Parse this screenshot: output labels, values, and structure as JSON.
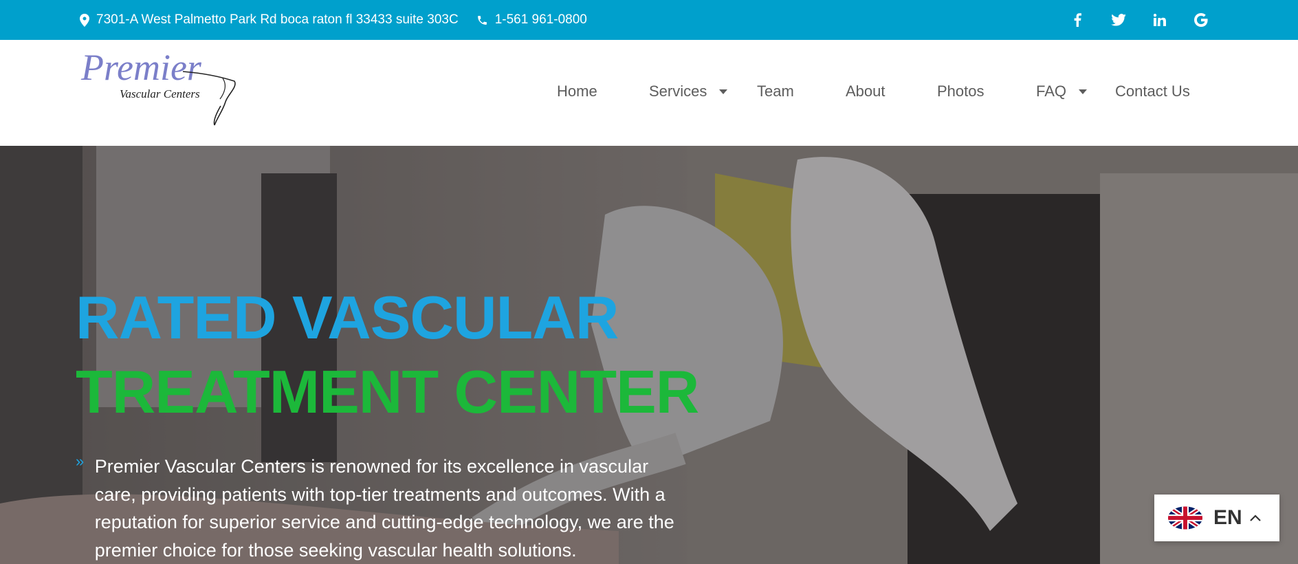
{
  "topbar": {
    "address": "7301-A West Palmetto Park Rd boca raton fl 33433 suite 303C",
    "phone": "1-561 961-0800",
    "social": [
      "facebook-icon",
      "twitter-icon",
      "linkedin-icon",
      "google-icon"
    ],
    "background": "#00a0cc"
  },
  "logo": {
    "line1": "Premier",
    "line2": "Vascular Centers"
  },
  "nav": {
    "items": [
      {
        "label": "Home",
        "dropdown": false
      },
      {
        "label": "Services",
        "dropdown": true
      },
      {
        "label": "Team",
        "dropdown": false
      },
      {
        "label": "About",
        "dropdown": false
      },
      {
        "label": "Photos",
        "dropdown": false
      },
      {
        "label": "FAQ",
        "dropdown": true
      },
      {
        "label": "Contact Us",
        "dropdown": false
      }
    ]
  },
  "hero": {
    "headline_line1": "RATED VASCULAR",
    "headline_line2": "TREATMENT CENTER",
    "headline_color1": "#1ea4e0",
    "headline_color2": "#1cb83a",
    "bullet": "»",
    "description": "Premier Vascular Centers is renowned for its excellence in vascular care, providing patients with top-tier treatments and outcomes. With a reputation for superior service and cutting-edge technology, we are the premier choice for those seeking vascular health solutions."
  },
  "language": {
    "code": "EN",
    "flag": "uk-flag-icon"
  }
}
